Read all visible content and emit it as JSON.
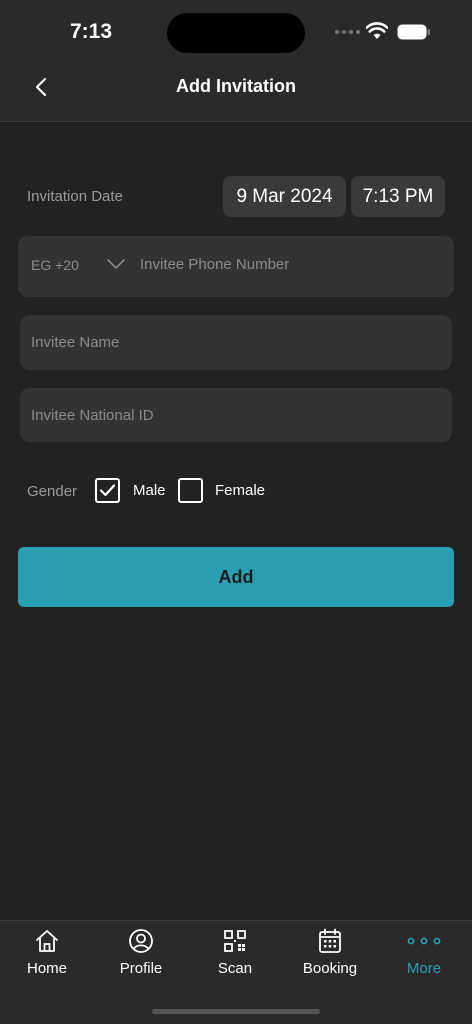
{
  "status": {
    "time": "7:13"
  },
  "header": {
    "title": "Add Invitation"
  },
  "form": {
    "date_label": "Invitation Date",
    "date_value": "9 Mar 2024",
    "time_value": "7:13 PM",
    "country_code": "EG +20",
    "phone_placeholder": "Invitee Phone Number",
    "name_placeholder": "Invitee Name",
    "national_id_placeholder": "Invitee National ID",
    "gender_label": "Gender",
    "male_label": "Male",
    "female_label": "Female",
    "male_checked": true,
    "female_checked": false,
    "add_label": "Add"
  },
  "tabs": [
    {
      "label": "Home",
      "icon": "home-icon"
    },
    {
      "label": "Profile",
      "icon": "user-circle-icon"
    },
    {
      "label": "Scan",
      "icon": "qr-code-icon"
    },
    {
      "label": "Booking",
      "icon": "calendar-icon"
    },
    {
      "label": "More",
      "icon": "more-dots-icon",
      "active": true
    }
  ],
  "colors": {
    "accent": "#2a9fb1",
    "background": "#222222",
    "surface": "#333333"
  }
}
